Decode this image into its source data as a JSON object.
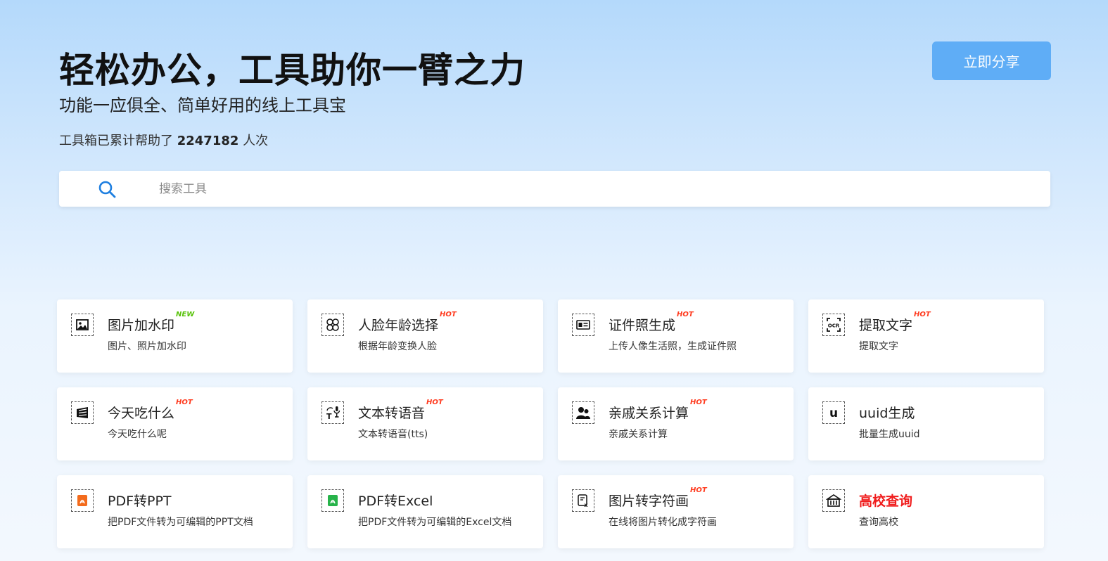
{
  "hero": {
    "title": "轻松办公，工具助你一臂之力",
    "subtitle": "功能一应俱全、简单好用的线上工具宝",
    "stat_prefix": "工具箱已累计帮助了",
    "stat_count": "2247182",
    "stat_suffix": "人次"
  },
  "share_button": "立即分享",
  "search": {
    "icon": "search-icon",
    "placeholder": "搜索工具",
    "value": ""
  },
  "colors": {
    "accent": "#5fadf6",
    "hot": "#ff3b1f",
    "new": "#58c20a",
    "highlight": "#f01c1c"
  },
  "tools": [
    {
      "name": "图片加水印",
      "badge": "NEW",
      "desc": "图片、照片加水印",
      "icon": "image-watermark-icon"
    },
    {
      "name": "人脸年龄选择",
      "badge": "HOT",
      "desc": "根据年龄变换人脸",
      "icon": "face-age-icon"
    },
    {
      "name": "证件照生成",
      "badge": "HOT",
      "desc": "上传人像生活照，生成证件照",
      "icon": "id-card-icon"
    },
    {
      "name": "提取文字",
      "badge": "HOT",
      "desc": "提取文字",
      "icon": "ocr-icon"
    },
    {
      "name": "今天吃什么",
      "badge": "HOT",
      "desc": "今天吃什么呢",
      "icon": "food-icon"
    },
    {
      "name": "文本转语音",
      "badge": "HOT",
      "desc": "文本转语音(tts)",
      "icon": "text-to-speech-icon"
    },
    {
      "name": "亲戚关系计算",
      "badge": "HOT",
      "desc": "亲戚关系计算",
      "icon": "family-relation-icon"
    },
    {
      "name": "uuid生成",
      "badge": "",
      "desc": "批量生成uuid",
      "icon": "uuid-icon"
    },
    {
      "name": "PDF转PPT",
      "badge": "",
      "desc": "把PDF文件转为可编辑的PPT文档",
      "icon": "pdf-to-ppt-icon"
    },
    {
      "name": "PDF转Excel",
      "badge": "",
      "desc": "把PDF文件转为可编辑的Excel文档",
      "icon": "pdf-to-excel-icon"
    },
    {
      "name": "图片转字符画",
      "badge": "HOT",
      "desc": "在线将图片转化成字符画",
      "icon": "image-to-ascii-icon"
    },
    {
      "name": "高校查询",
      "badge": "",
      "desc": "查询高校",
      "icon": "university-icon",
      "highlight": true
    }
  ]
}
